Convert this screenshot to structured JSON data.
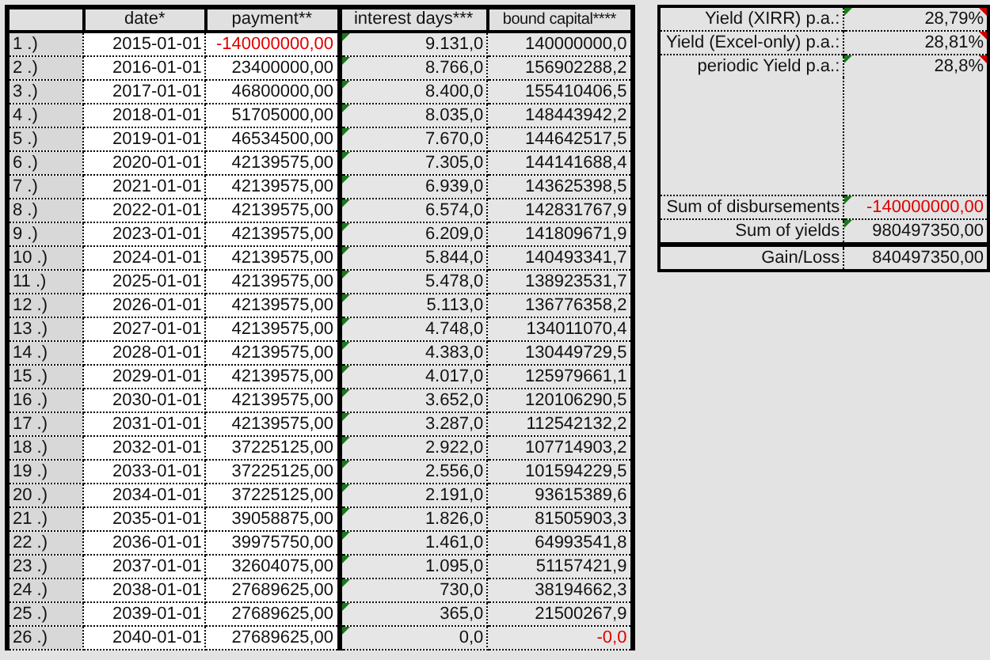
{
  "table": {
    "columns": [
      "date*",
      "payment**",
      "interest days***",
      "bound capital****"
    ],
    "rows": [
      {
        "label": "1 .)",
        "date": "2015-01-01",
        "payment": "-140000000,00",
        "payment_negative": true,
        "days": "9.131,0",
        "capital": "140000000,0",
        "capital_negative": false,
        "flagged": true
      },
      {
        "label": "2 .)",
        "date": "2016-01-01",
        "payment": "23400000,00",
        "payment_negative": false,
        "days": "8.766,0",
        "capital": "156902288,2",
        "capital_negative": false,
        "flagged": true
      },
      {
        "label": "3 .)",
        "date": "2017-01-01",
        "payment": "46800000,00",
        "payment_negative": false,
        "days": "8.400,0",
        "capital": "155410406,5",
        "capital_negative": false,
        "flagged": true
      },
      {
        "label": "4 .)",
        "date": "2018-01-01",
        "payment": "51705000,00",
        "payment_negative": false,
        "days": "8.035,0",
        "capital": "148443942,2",
        "capital_negative": false,
        "flagged": true
      },
      {
        "label": "5 .)",
        "date": "2019-01-01",
        "payment": "46534500,00",
        "payment_negative": false,
        "days": "7.670,0",
        "capital": "144642517,5",
        "capital_negative": false,
        "flagged": true
      },
      {
        "label": "6 .)",
        "date": "2020-01-01",
        "payment": "42139575,00",
        "payment_negative": false,
        "days": "7.305,0",
        "capital": "144141688,4",
        "capital_negative": false,
        "flagged": true
      },
      {
        "label": "7 .)",
        "date": "2021-01-01",
        "payment": "42139575,00",
        "payment_negative": false,
        "days": "6.939,0",
        "capital": "143625398,5",
        "capital_negative": false,
        "flagged": true
      },
      {
        "label": "8 .)",
        "date": "2022-01-01",
        "payment": "42139575,00",
        "payment_negative": false,
        "days": "6.574,0",
        "capital": "142831767,9",
        "capital_negative": false,
        "flagged": true
      },
      {
        "label": "9 .)",
        "date": "2023-01-01",
        "payment": "42139575,00",
        "payment_negative": false,
        "days": "6.209,0",
        "capital": "141809671,9",
        "capital_negative": false,
        "flagged": true
      },
      {
        "label": "10 .)",
        "date": "2024-01-01",
        "payment": "42139575,00",
        "payment_negative": false,
        "days": "5.844,0",
        "capital": "140493341,7",
        "capital_negative": false,
        "flagged": true
      },
      {
        "label": "11 .)",
        "date": "2025-01-01",
        "payment": "42139575,00",
        "payment_negative": false,
        "days": "5.478,0",
        "capital": "138923531,7",
        "capital_negative": false,
        "flagged": true
      },
      {
        "label": "12 .)",
        "date": "2026-01-01",
        "payment": "42139575,00",
        "payment_negative": false,
        "days": "5.113,0",
        "capital": "136776358,2",
        "capital_negative": false,
        "flagged": true
      },
      {
        "label": "13 .)",
        "date": "2027-01-01",
        "payment": "42139575,00",
        "payment_negative": false,
        "days": "4.748,0",
        "capital": "134011070,4",
        "capital_negative": false,
        "flagged": true
      },
      {
        "label": "14 .)",
        "date": "2028-01-01",
        "payment": "42139575,00",
        "payment_negative": false,
        "days": "4.383,0",
        "capital": "130449729,5",
        "capital_negative": false,
        "flagged": true
      },
      {
        "label": "15 .)",
        "date": "2029-01-01",
        "payment": "42139575,00",
        "payment_negative": false,
        "days": "4.017,0",
        "capital": "125979661,1",
        "capital_negative": false,
        "flagged": true
      },
      {
        "label": "16 .)",
        "date": "2030-01-01",
        "payment": "42139575,00",
        "payment_negative": false,
        "days": "3.652,0",
        "capital": "120106290,5",
        "capital_negative": false,
        "flagged": true
      },
      {
        "label": "17 .)",
        "date": "2031-01-01",
        "payment": "42139575,00",
        "payment_negative": false,
        "days": "3.287,0",
        "capital": "112542132,2",
        "capital_negative": false,
        "flagged": true
      },
      {
        "label": "18 .)",
        "date": "2032-01-01",
        "payment": "37225125,00",
        "payment_negative": false,
        "days": "2.922,0",
        "capital": "107714903,2",
        "capital_negative": false,
        "flagged": true
      },
      {
        "label": "19 .)",
        "date": "2033-01-01",
        "payment": "37225125,00",
        "payment_negative": false,
        "days": "2.556,0",
        "capital": "101594229,5",
        "capital_negative": false,
        "flagged": true
      },
      {
        "label": "20 .)",
        "date": "2034-01-01",
        "payment": "37225125,00",
        "payment_negative": false,
        "days": "2.191,0",
        "capital": "93615389,6",
        "capital_negative": false,
        "flagged": true
      },
      {
        "label": "21 .)",
        "date": "2035-01-01",
        "payment": "39058875,00",
        "payment_negative": false,
        "days": "1.826,0",
        "capital": "81505903,3",
        "capital_negative": false,
        "flagged": true
      },
      {
        "label": "22 .)",
        "date": "2036-01-01",
        "payment": "39975750,00",
        "payment_negative": false,
        "days": "1.461,0",
        "capital": "64993541,8",
        "capital_negative": false,
        "flagged": true
      },
      {
        "label": "23 .)",
        "date": "2037-01-01",
        "payment": "32604075,00",
        "payment_negative": false,
        "days": "1.095,0",
        "capital": "51157421,9",
        "capital_negative": false,
        "flagged": true
      },
      {
        "label": "24 .)",
        "date": "2038-01-01",
        "payment": "27689625,00",
        "payment_negative": false,
        "days": "730,0",
        "capital": "38194662,3",
        "capital_negative": false,
        "flagged": true
      },
      {
        "label": "25 .)",
        "date": "2039-01-01",
        "payment": "27689625,00",
        "payment_negative": false,
        "days": "365,0",
        "capital": "21500267,9",
        "capital_negative": false,
        "flagged": true
      },
      {
        "label": "26 .)",
        "date": "2040-01-01",
        "payment": "27689625,00",
        "payment_negative": false,
        "days": "0,0",
        "capital": "-0,0",
        "capital_negative": true,
        "flagged": true
      }
    ]
  },
  "summary": [
    {
      "kind": "yield",
      "label": "Yield (XIRR) p.a.:",
      "value": "28,79%",
      "flagged": true,
      "comment": true,
      "negative": false
    },
    {
      "kind": "yield",
      "label": "Yield (Excel-only) p.a.:",
      "value": "28,81%",
      "flagged": false,
      "comment": true,
      "negative": false
    },
    {
      "kind": "yield",
      "label": "periodic Yield p.a.:",
      "value": "28,8%",
      "flagged": true,
      "comment": true,
      "negative": false
    },
    {
      "kind": "sum",
      "label": "Sum of disbursements",
      "value": "-140000000,00",
      "flagged": true,
      "comment": false,
      "negative": true
    },
    {
      "kind": "sum",
      "label": "Sum of  yields",
      "value": "980497350,00",
      "flagged": true,
      "comment": false,
      "negative": false
    },
    {
      "kind": "total",
      "label": "Gain/Loss",
      "value": "840497350,00",
      "flagged": false,
      "comment": false,
      "negative": false
    }
  ]
}
